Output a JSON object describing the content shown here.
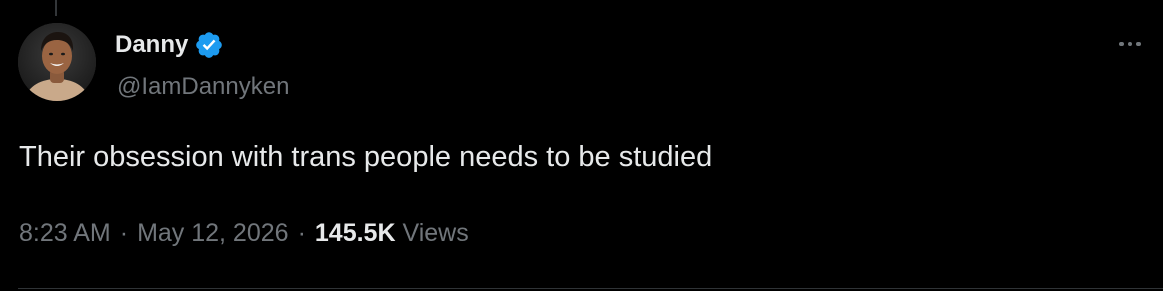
{
  "tweet": {
    "author": {
      "display_name": "Danny",
      "handle": "@IamDannyken",
      "verified": true,
      "avatar_icon": "profile-photo-icon",
      "verified_icon": "verified-badge-icon"
    },
    "more_icon": "more-options-icon",
    "text": "Their obsession with trans people needs to be studied",
    "meta": {
      "time": "8:23 AM",
      "separator": "·",
      "date": "May 12, 2026",
      "views_count": "145.5K",
      "views_label": "Views"
    }
  },
  "colors": {
    "background": "#000000",
    "primary_text": "#e7e9ea",
    "secondary_text": "#71767b",
    "verified_blue": "#1d9bf0",
    "divider": "#2f3336"
  }
}
